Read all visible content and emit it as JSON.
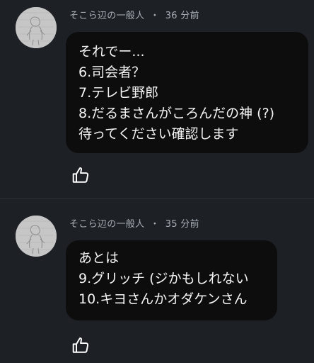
{
  "comments": [
    {
      "author": "そこら辺の一般人",
      "separator": "・",
      "time": "36 分前",
      "lines": [
        "それでー...",
        "6.司会者？",
        "7.テレビ野郎",
        "8.だるまさんがころんだの神 (?)",
        "待ってください確認します"
      ],
      "like_icon": "thumbs-up-icon"
    },
    {
      "author": "そこら辺の一般人",
      "separator": "・",
      "time": "35 分前",
      "lines": [
        "あとは",
        "9.グリッチ (ジかもしれない",
        "10.キヨさんかオダケンさん"
      ],
      "like_icon": "thumbs-up-icon"
    }
  ],
  "colors": {
    "background": "#1d2126",
    "bubble": "#0d0d0e",
    "meta_text": "#a9afb6",
    "text": "#f4f4f4"
  }
}
